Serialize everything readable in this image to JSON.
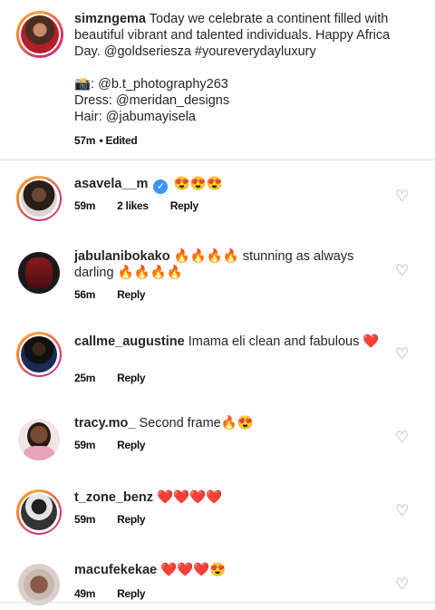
{
  "caption": {
    "username": "simzngema",
    "text": " Today we celebrate a continent filled with beautiful vibrant and talented individuals. Happy Africa Day. @goldseriesza #youreverydayluxury",
    "credits": [
      "📸: @b.t_photography263",
      "Dress: @meridan_designs",
      "Hair: @jabumayisela"
    ],
    "time": "57m",
    "edited": "• Edited"
  },
  "comments": [
    {
      "username": "asavela__m",
      "verified": true,
      "text": "😍😍😍",
      "time": "59m",
      "likes": "2 likes",
      "reply": "Reply"
    },
    {
      "username": "jabulanibokako",
      "text": "🔥🔥🔥🔥 stunning as always darling 🔥🔥🔥🔥",
      "time": "56m",
      "reply": "Reply"
    },
    {
      "username": "callme_augustine",
      "text": "Imama eli clean and fabulous ❤️",
      "time": "25m",
      "reply": "Reply"
    },
    {
      "username": "tracy.mo_",
      "text": "Second frame🔥😍",
      "time": "59m",
      "reply": "Reply"
    },
    {
      "username": "t_zone_benz",
      "text": "❤️❤️❤️❤️",
      "time": "59m",
      "reply": "Reply"
    },
    {
      "username": "macufekekae",
      "text": "❤️❤️❤️😍",
      "time": "49m",
      "reply": "Reply"
    }
  ],
  "icons": {
    "like": "heart-outline-icon",
    "verified": "verified-badge-icon"
  },
  "colors": {
    "ring": "#e1306c",
    "verified": "#3897f0",
    "heart": "#8e8e8e"
  }
}
